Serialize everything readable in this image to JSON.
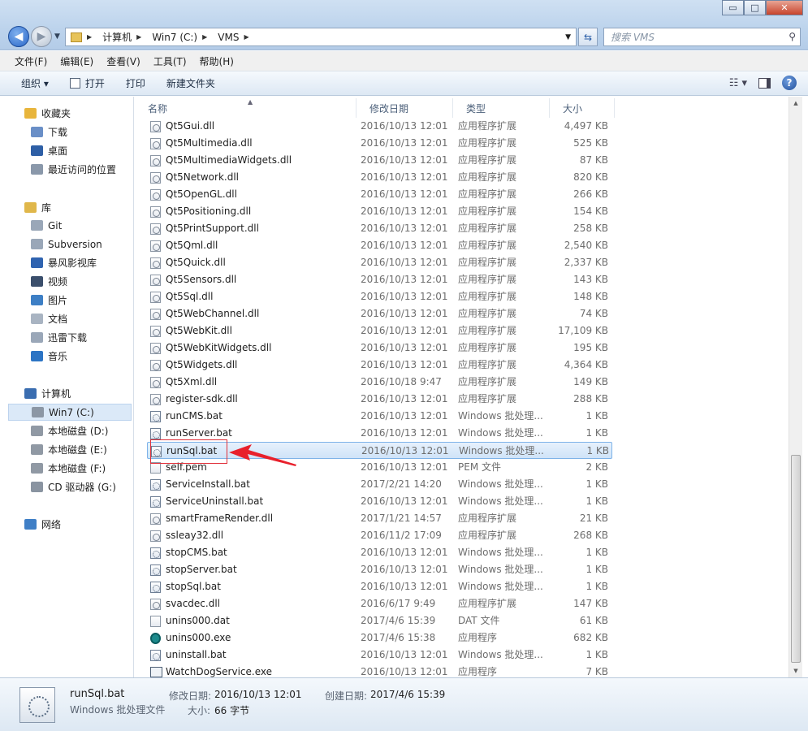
{
  "window": {
    "controls": {
      "minimize": "▭",
      "maximize": "□",
      "close": "✕"
    }
  },
  "address": {
    "crumbs": [
      "计算机",
      "Win7 (C:)",
      "VMS"
    ],
    "search_placeholder": "搜索 VMS"
  },
  "menu": [
    "文件(F)",
    "编辑(E)",
    "查看(V)",
    "工具(T)",
    "帮助(H)"
  ],
  "toolbar": {
    "organize": "组织 ▾",
    "open": "打开",
    "print": "打印",
    "new_folder": "新建文件夹",
    "help": "?"
  },
  "sidebar": {
    "items": [
      {
        "label": "收藏夹",
        "icon": "star-icon",
        "color": "#e8b53c",
        "level": 0
      },
      {
        "label": "下载",
        "icon": "download-folder-icon",
        "color": "#6a8fc7",
        "level": 1
      },
      {
        "label": "桌面",
        "icon": "desktop-icon",
        "color": "#2e5fa6",
        "level": 1
      },
      {
        "label": "最近访问的位置",
        "icon": "recent-places-icon",
        "color": "#8a98aa",
        "level": 1
      },
      {
        "label": "库",
        "icon": "library-icon",
        "color": "#e0b74a",
        "level": 0
      },
      {
        "label": "Git",
        "icon": "document-library-icon",
        "color": "#9aa7b8",
        "level": 1
      },
      {
        "label": "Subversion",
        "icon": "document-library-icon",
        "color": "#9aa7b8",
        "level": 1
      },
      {
        "label": "暴风影视库",
        "icon": "video-library-icon",
        "color": "#2f63b0",
        "level": 1
      },
      {
        "label": "视频",
        "icon": "video-icon",
        "color": "#3b4f6c",
        "level": 1
      },
      {
        "label": "图片",
        "icon": "picture-icon",
        "color": "#3d7fc5",
        "level": 1
      },
      {
        "label": "文档",
        "icon": "document-icon",
        "color": "#a9b4c2",
        "level": 1
      },
      {
        "label": "迅雷下载",
        "icon": "thunder-download-icon",
        "color": "#9aa7b8",
        "level": 1
      },
      {
        "label": "音乐",
        "icon": "music-icon",
        "color": "#2c74c4",
        "level": 1
      },
      {
        "label": "计算机",
        "icon": "computer-icon",
        "color": "#3a6db0",
        "level": 0
      },
      {
        "label": "Win7 (C:)",
        "icon": "system-drive-icon",
        "color": "#8c97a5",
        "level": 1,
        "selected": true
      },
      {
        "label": "本地磁盘 (D:)",
        "icon": "drive-icon",
        "color": "#9099a4",
        "level": 1
      },
      {
        "label": "本地磁盘 (E:)",
        "icon": "drive-icon",
        "color": "#9099a4",
        "level": 1
      },
      {
        "label": "本地磁盘 (F:)",
        "icon": "drive-icon",
        "color": "#9099a4",
        "level": 1
      },
      {
        "label": "CD 驱动器 (G:)",
        "icon": "cd-drive-icon",
        "color": "#8a94a1",
        "level": 1
      },
      {
        "label": "网络",
        "icon": "network-icon",
        "color": "#3f7fc6",
        "level": 0
      }
    ]
  },
  "columns": {
    "name": "名称",
    "date": "修改日期",
    "type": "类型",
    "size": "大小"
  },
  "files": [
    {
      "name": "Qt5Gui.dll",
      "date": "2016/10/13 12:01",
      "type": "应用程序扩展",
      "size": "4,497 KB",
      "icon": "dll"
    },
    {
      "name": "Qt5Multimedia.dll",
      "date": "2016/10/13 12:01",
      "type": "应用程序扩展",
      "size": "525 KB",
      "icon": "dll"
    },
    {
      "name": "Qt5MultimediaWidgets.dll",
      "date": "2016/10/13 12:01",
      "type": "应用程序扩展",
      "size": "87 KB",
      "icon": "dll"
    },
    {
      "name": "Qt5Network.dll",
      "date": "2016/10/13 12:01",
      "type": "应用程序扩展",
      "size": "820 KB",
      "icon": "dll"
    },
    {
      "name": "Qt5OpenGL.dll",
      "date": "2016/10/13 12:01",
      "type": "应用程序扩展",
      "size": "266 KB",
      "icon": "dll"
    },
    {
      "name": "Qt5Positioning.dll",
      "date": "2016/10/13 12:01",
      "type": "应用程序扩展",
      "size": "154 KB",
      "icon": "dll"
    },
    {
      "name": "Qt5PrintSupport.dll",
      "date": "2016/10/13 12:01",
      "type": "应用程序扩展",
      "size": "258 KB",
      "icon": "dll"
    },
    {
      "name": "Qt5Qml.dll",
      "date": "2016/10/13 12:01",
      "type": "应用程序扩展",
      "size": "2,540 KB",
      "icon": "dll"
    },
    {
      "name": "Qt5Quick.dll",
      "date": "2016/10/13 12:01",
      "type": "应用程序扩展",
      "size": "2,337 KB",
      "icon": "dll"
    },
    {
      "name": "Qt5Sensors.dll",
      "date": "2016/10/13 12:01",
      "type": "应用程序扩展",
      "size": "143 KB",
      "icon": "dll"
    },
    {
      "name": "Qt5Sql.dll",
      "date": "2016/10/13 12:01",
      "type": "应用程序扩展",
      "size": "148 KB",
      "icon": "dll"
    },
    {
      "name": "Qt5WebChannel.dll",
      "date": "2016/10/13 12:01",
      "type": "应用程序扩展",
      "size": "74 KB",
      "icon": "dll"
    },
    {
      "name": "Qt5WebKit.dll",
      "date": "2016/10/13 12:01",
      "type": "应用程序扩展",
      "size": "17,109 KB",
      "icon": "dll"
    },
    {
      "name": "Qt5WebKitWidgets.dll",
      "date": "2016/10/13 12:01",
      "type": "应用程序扩展",
      "size": "195 KB",
      "icon": "dll"
    },
    {
      "name": "Qt5Widgets.dll",
      "date": "2016/10/13 12:01",
      "type": "应用程序扩展",
      "size": "4,364 KB",
      "icon": "dll"
    },
    {
      "name": "Qt5Xml.dll",
      "date": "2016/10/18 9:47",
      "type": "应用程序扩展",
      "size": "149 KB",
      "icon": "dll"
    },
    {
      "name": "register-sdk.dll",
      "date": "2016/10/13 12:01",
      "type": "应用程序扩展",
      "size": "288 KB",
      "icon": "dll"
    },
    {
      "name": "runCMS.bat",
      "date": "2016/10/13 12:01",
      "type": "Windows 批处理...",
      "size": "1 KB",
      "icon": "bat"
    },
    {
      "name": "runServer.bat",
      "date": "2016/10/13 12:01",
      "type": "Windows 批处理...",
      "size": "1 KB",
      "icon": "bat"
    },
    {
      "name": "runSql.bat",
      "date": "2016/10/13 12:01",
      "type": "Windows 批处理...",
      "size": "1 KB",
      "icon": "bat",
      "selected": true
    },
    {
      "name": "self.pem",
      "date": "2016/10/13 12:01",
      "type": "PEM 文件",
      "size": "2 KB",
      "icon": "file"
    },
    {
      "name": "ServiceInstall.bat",
      "date": "2017/2/21 14:20",
      "type": "Windows 批处理...",
      "size": "1 KB",
      "icon": "bat"
    },
    {
      "name": "ServiceUninstall.bat",
      "date": "2016/10/13 12:01",
      "type": "Windows 批处理...",
      "size": "1 KB",
      "icon": "bat"
    },
    {
      "name": "smartFrameRender.dll",
      "date": "2017/1/21 14:57",
      "type": "应用程序扩展",
      "size": "21 KB",
      "icon": "dll"
    },
    {
      "name": "ssleay32.dll",
      "date": "2016/11/2 17:09",
      "type": "应用程序扩展",
      "size": "268 KB",
      "icon": "dll"
    },
    {
      "name": "stopCMS.bat",
      "date": "2016/10/13 12:01",
      "type": "Windows 批处理...",
      "size": "1 KB",
      "icon": "bat"
    },
    {
      "name": "stopServer.bat",
      "date": "2016/10/13 12:01",
      "type": "Windows 批处理...",
      "size": "1 KB",
      "icon": "bat"
    },
    {
      "name": "stopSql.bat",
      "date": "2016/10/13 12:01",
      "type": "Windows 批处理...",
      "size": "1 KB",
      "icon": "bat"
    },
    {
      "name": "svacdec.dll",
      "date": "2016/6/17 9:49",
      "type": "应用程序扩展",
      "size": "147 KB",
      "icon": "dll"
    },
    {
      "name": "unins000.dat",
      "date": "2017/4/6 15:39",
      "type": "DAT 文件",
      "size": "61 KB",
      "icon": "file"
    },
    {
      "name": "unins000.exe",
      "date": "2017/4/6 15:38",
      "type": "应用程序",
      "size": "682 KB",
      "icon": "exe"
    },
    {
      "name": "uninstall.bat",
      "date": "2016/10/13 12:01",
      "type": "Windows 批处理...",
      "size": "1 KB",
      "icon": "bat"
    },
    {
      "name": "WatchDogService.exe",
      "date": "2016/10/13 12:01",
      "type": "应用程序",
      "size": "7 KB",
      "icon": "app"
    }
  ],
  "status": {
    "name": "runSql.bat",
    "type": "Windows 批处理文件",
    "modified_label": "修改日期:",
    "modified": "2016/10/13 12:01",
    "created_label": "创建日期:",
    "created": "2017/4/6 15:39",
    "size_label": "大小:",
    "size": "66 字节"
  }
}
